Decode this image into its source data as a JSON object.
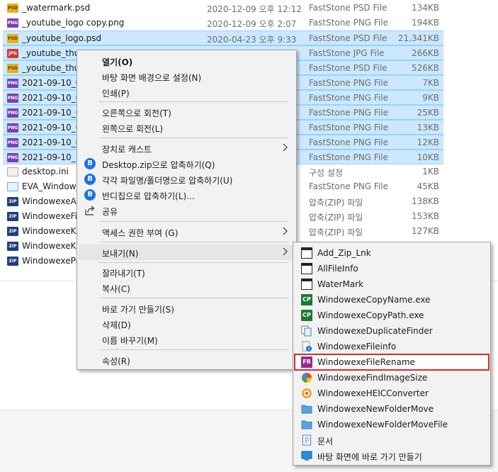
{
  "files": [
    {
      "icon": "psd",
      "icon_text": "PSD",
      "name": "_watermark.psd",
      "date": "2020-12-09 오후 12:12",
      "type": "FastStone PSD File",
      "size": "134KB",
      "selected": false
    },
    {
      "icon": "png",
      "icon_text": "PNG",
      "name": "_youtube_logo copy.png",
      "date": "2020-12-09 오후 2:07",
      "type": "FastStone PNG File",
      "size": "194KB",
      "selected": false
    },
    {
      "icon": "psd",
      "icon_text": "PSD",
      "name": "_youtube_logo.psd",
      "date": "2020-04-23 오후 9:33",
      "type": "FastStone PSD File",
      "size": "21,341KB",
      "selected": true
    },
    {
      "icon": "jpg",
      "icon_text": "JPG",
      "name": "_youtube_thum",
      "date": "",
      "type": "FastStone JPG File",
      "size": "266KB",
      "selected": true
    },
    {
      "icon": "psd",
      "icon_text": "PSD",
      "name": "_youtube_thum",
      "date": "",
      "type": "FastStone PSD File",
      "size": "526KB",
      "selected": true
    },
    {
      "icon": "png",
      "icon_text": "PNG",
      "name": "2021-09-10_0",
      "date": "",
      "type": "FastStone PNG File",
      "size": "7KB",
      "selected": true
    },
    {
      "icon": "png",
      "icon_text": "PNG",
      "name": "2021-09-10_0",
      "date": "",
      "type": "FastStone PNG File",
      "size": "9KB",
      "selected": true
    },
    {
      "icon": "png",
      "icon_text": "PNG",
      "name": "2021-09-10_0",
      "date": "",
      "type": "FastStone PNG File",
      "size": "25KB",
      "selected": true
    },
    {
      "icon": "png",
      "icon_text": "PNG",
      "name": "2021-09-10_0",
      "date": "",
      "type": "FastStone PNG File",
      "size": "13KB",
      "selected": true
    },
    {
      "icon": "png",
      "icon_text": "PNG",
      "name": "2021-09-10_0",
      "date": "",
      "type": "FastStone PNG File",
      "size": "12KB",
      "selected": true
    },
    {
      "icon": "png",
      "icon_text": "PNG",
      "name": "2021-09-10_1",
      "date": "",
      "type": "FastStone PNG File",
      "size": "10KB",
      "selected": true
    },
    {
      "icon": "ini",
      "icon_text": "",
      "name": "desktop.ini",
      "date": "",
      "type": "구성 설정",
      "size": "1KB",
      "selected": false
    },
    {
      "icon": "eva",
      "icon_text": "",
      "name": "EVA_Window_",
      "date": "",
      "type": "FastStone PNG File",
      "size": "45KB",
      "selected": false
    },
    {
      "icon": "zip",
      "icon_text": "ZIP",
      "name": "WindowexeAut",
      "date": "",
      "type": "압축(ZIP) 파일",
      "size": "138KB",
      "selected": false
    },
    {
      "icon": "zip",
      "icon_text": "ZIP",
      "name": "WindowexeFile",
      "date": "",
      "type": "압축(ZIP) 파일",
      "size": "153KB",
      "selected": false
    },
    {
      "icon": "zip",
      "icon_text": "ZIP",
      "name": "WindowexeKak",
      "date": "",
      "type": "압축(ZIP) 파일",
      "size": "127KB",
      "selected": false
    },
    {
      "icon": "zip",
      "icon_text": "ZIP",
      "name": "WindowexeKak",
      "date": "",
      "type": "",
      "size": "",
      "selected": false
    },
    {
      "icon": "zip",
      "icon_text": "ZIP",
      "name": "WindowexePro",
      "date": "",
      "type": "",
      "size": "",
      "selected": false
    }
  ],
  "context_menu": {
    "open": "열기(O)",
    "set_wallpaper": "바탕 화면 배경으로 설정(N)",
    "print": "인쇄(P)",
    "rotate_right": "오른쪽으로 회전(T)",
    "rotate_left": "왼쪽으로 회전(L)",
    "cast": "장치로 캐스트",
    "zip_desktop": "Desktop.zip으로 압축하기(Q)",
    "zip_each": "각각 파일명/폴더명으로 압축하기(U)",
    "bandizip": "반디집으로 압축하기(L)...",
    "share": "공유",
    "give_access": "액세스 권한 부여 (G)",
    "send_to": "보내기(N)",
    "cut": "잘라내기(T)",
    "copy": "복사(C)",
    "create_shortcut": "바로 가기 만들기(S)",
    "delete": "삭제(D)",
    "rename": "이름 바꾸기(M)",
    "properties": "속성(R)",
    "badge_letter": "B",
    "cp_label": "CP",
    "fr_label": "FR"
  },
  "send_to_menu": {
    "items": [
      "Add_Zip_Lnk",
      "AllFileInfo",
      "WaterMark",
      "WindowexeCopyName.exe",
      "WindowexeCopyPath.exe",
      "WindowexeDuplicateFinder",
      "WindowexeFileinfo",
      "WindowexeFileRename",
      "WindowexeFindImageSize",
      "WindowexeHEICConverter",
      "WindowexeNewFolderMove",
      "WindowexeNewFolderMoveFile",
      "문서",
      "바탕 화면에 바로 가기 만들기"
    ]
  },
  "colors": {
    "selection": "#cce8ff",
    "highlight_outline": "#d62b2b"
  }
}
